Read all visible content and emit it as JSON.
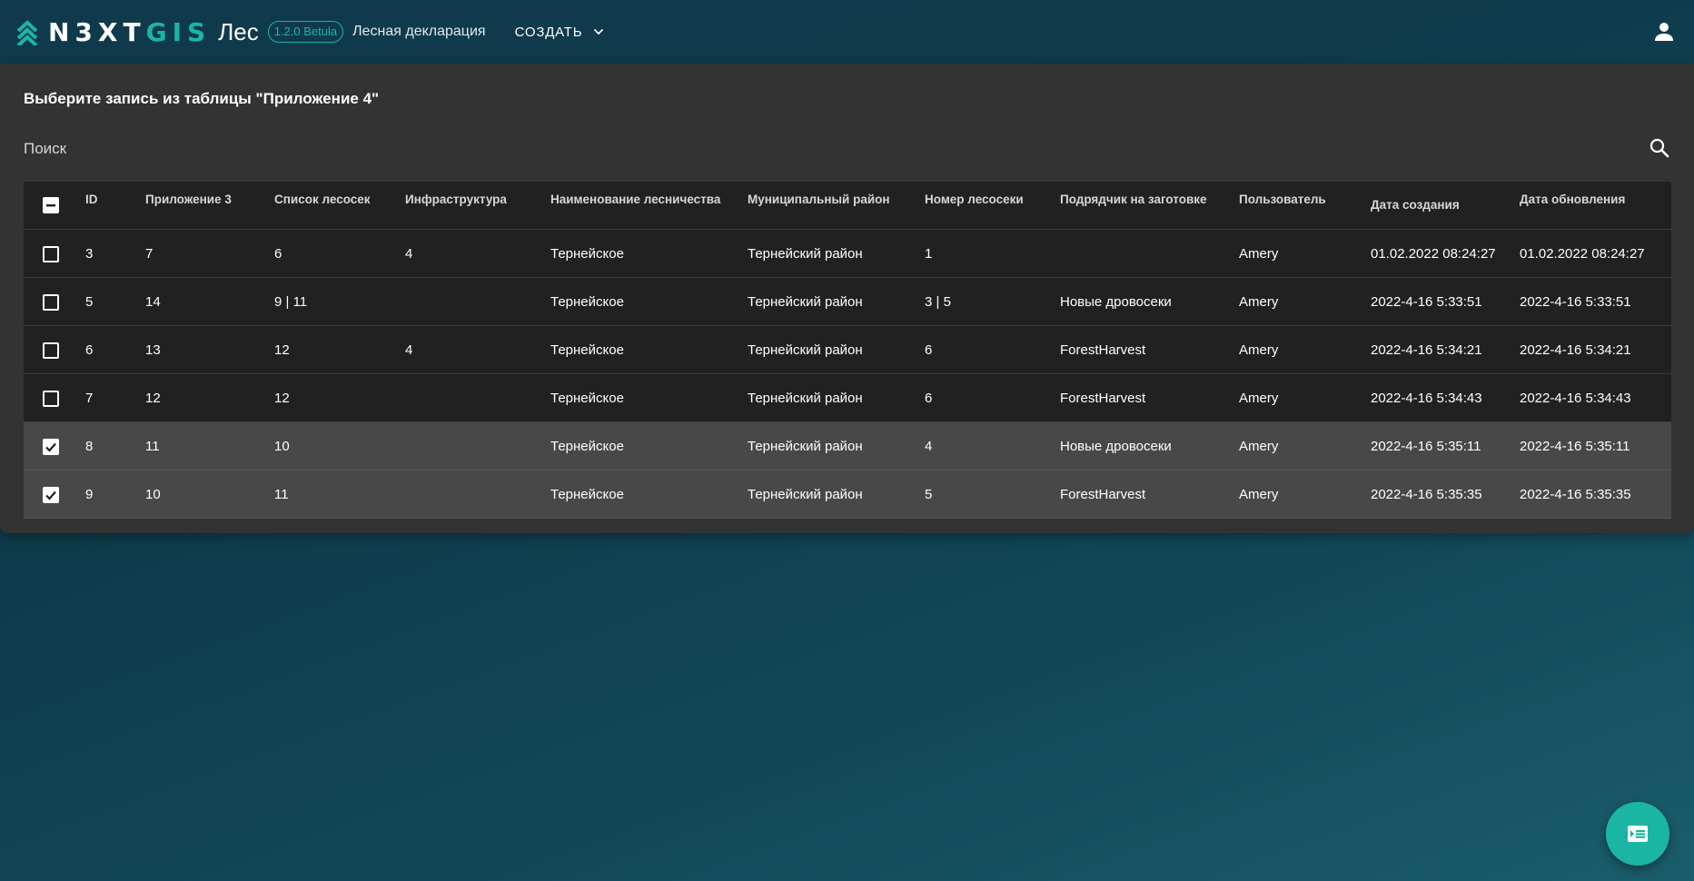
{
  "header": {
    "logo_word_prefix": "N3XT",
    "logo_word_suffix": "GIS",
    "app_name": "Лес",
    "version": "1.2.0 Betula",
    "subtitle": "Лесная декларация",
    "create_label": "СОЗДАТЬ"
  },
  "panel": {
    "title": "Выберите запись из таблицы \"Приложение 4\"",
    "search_placeholder": "Поиск",
    "search_value": ""
  },
  "table": {
    "select_all_state": "indeterminate",
    "columns": [
      "ID",
      "Приложение 3",
      "Список лесосек",
      "Инфраструктура",
      "Наименование лесничества",
      "Муниципальный район",
      "Номер лесосеки",
      "Подрядчик на заготовке",
      "Пользователь",
      "Дата создания",
      "Дата обновления"
    ],
    "rows": [
      {
        "checked": false,
        "cells": [
          "3",
          "7",
          "6",
          "4",
          "Тернейское",
          "Тернейский район",
          "1",
          "",
          "Amery",
          "01.02.2022 08:24:27",
          "01.02.2022 08:24:27"
        ]
      },
      {
        "checked": false,
        "cells": [
          "5",
          "14",
          "9 | 11",
          "",
          "Тернейское",
          "Тернейский район",
          "3 | 5",
          "Новые дровосеки",
          "Amery",
          "2022-4-16 5:33:51",
          "2022-4-16 5:33:51"
        ]
      },
      {
        "checked": false,
        "cells": [
          "6",
          "13",
          "12",
          "4",
          "Тернейское",
          "Тернейский район",
          "6",
          "ForestHarvest",
          "Amery",
          "2022-4-16 5:34:21",
          "2022-4-16 5:34:21"
        ]
      },
      {
        "checked": false,
        "cells": [
          "7",
          "12",
          "12",
          "",
          "Тернейское",
          "Тернейский район",
          "6",
          "ForestHarvest",
          "Amery",
          "2022-4-16 5:34:43",
          "2022-4-16 5:34:43"
        ]
      },
      {
        "checked": true,
        "cells": [
          "8",
          "11",
          "10",
          "",
          "Тернейское",
          "Тернейский район",
          "4",
          "Новые дровосеки",
          "Amery",
          "2022-4-16 5:35:11",
          "2022-4-16 5:35:11"
        ]
      },
      {
        "checked": true,
        "cells": [
          "9",
          "10",
          "11",
          "",
          "Тернейское",
          "Тернейский район",
          "5",
          "ForestHarvest",
          "Amery",
          "2022-4-16 5:35:35",
          "2022-4-16 5:35:35"
        ]
      }
    ]
  },
  "icons": {
    "logo": "nextgis-logo-icon",
    "dropdown": "chevron-down-icon",
    "user": "account-icon",
    "search": "search-icon",
    "fab": "form-select-icon"
  },
  "colors": {
    "accent": "#1bb5a3",
    "panel": "#333333",
    "table": "#212121",
    "selected_row": "#484848"
  }
}
